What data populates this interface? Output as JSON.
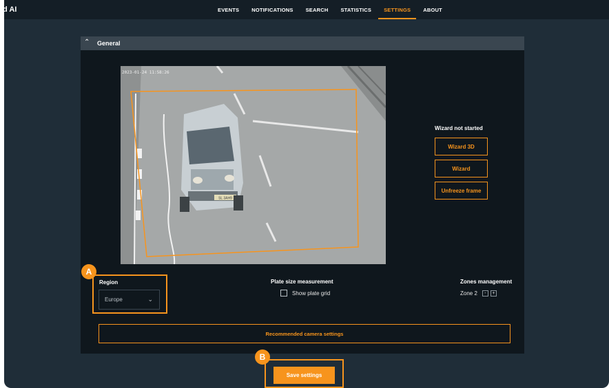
{
  "app": {
    "brand": "d AI"
  },
  "nav": {
    "items": [
      {
        "label": "EVENTS"
      },
      {
        "label": "NOTIFICATIONS"
      },
      {
        "label": "SEARCH"
      },
      {
        "label": "STATISTICS"
      },
      {
        "label": "SETTINGS",
        "active": true
      },
      {
        "label": "ABOUT"
      }
    ]
  },
  "section": {
    "title": "General",
    "expanded": true
  },
  "camera": {
    "timestamp": "2023-01-24 11:58:26",
    "plate_text": "SL 3AH9"
  },
  "wizard": {
    "status": "Wizard not started",
    "wizard3d_label": "Wizard 3D",
    "wizard_label": "Wizard",
    "unfreeze_label": "Unfreeze frame"
  },
  "region": {
    "label": "Region",
    "selected": "Europe"
  },
  "plate_size": {
    "label": "Plate size measurement",
    "checkbox_label": "Show plate grid",
    "checked": false
  },
  "zones": {
    "label": "Zones management",
    "zone_name": "Zone 2",
    "minus": "-",
    "plus": "+"
  },
  "recommended_label": "Recommended camera settings",
  "save_label": "Save settings",
  "callouts": {
    "a": "A",
    "b": "B"
  },
  "colors": {
    "accent": "#f7941d",
    "background": "#1f2d38",
    "panel": "#0f171d",
    "topbar": "#141e26"
  }
}
